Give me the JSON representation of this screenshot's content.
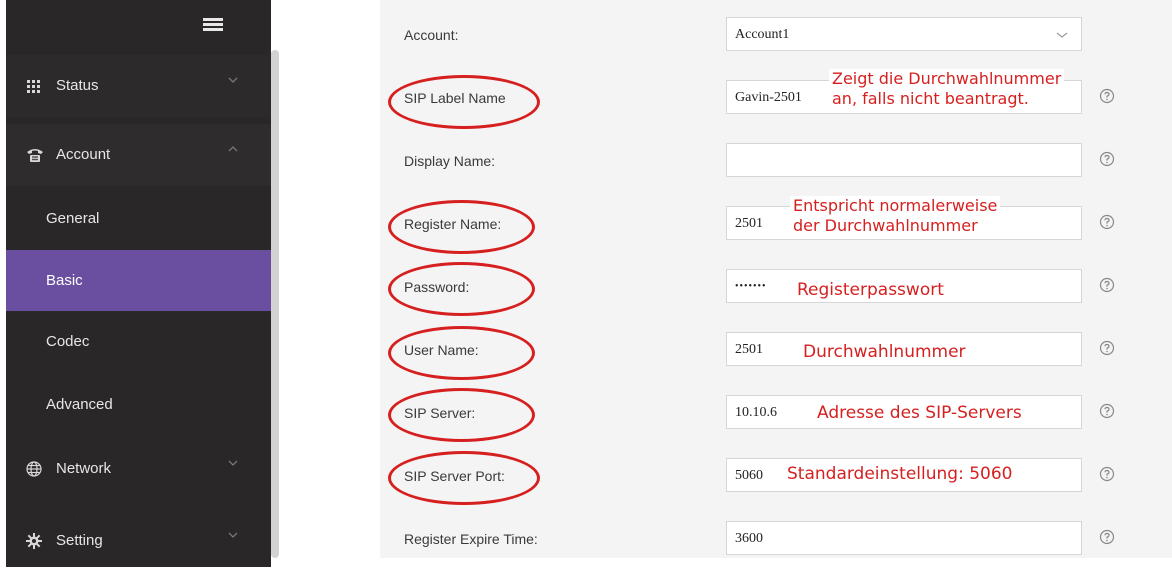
{
  "sidebar": {
    "items": [
      {
        "label": "Status",
        "icon": "grid-icon"
      },
      {
        "label": "Account",
        "icon": "phone-icon"
      },
      {
        "label": "General"
      },
      {
        "label": "Basic"
      },
      {
        "label": "Codec"
      },
      {
        "label": "Advanced"
      },
      {
        "label": "Network",
        "icon": "globe-icon"
      },
      {
        "label": "Setting",
        "icon": "gear-icon"
      }
    ]
  },
  "form": {
    "account": {
      "label": "Account:",
      "value": "Account1"
    },
    "sip_label_name": {
      "label": "SIP Label Name",
      "value": "Gavin-2501"
    },
    "display_name": {
      "label": "Display Name:",
      "value": ""
    },
    "register_name": {
      "label": "Register Name:",
      "value": "2501"
    },
    "password": {
      "label": "Password:",
      "value": "•••••••"
    },
    "user_name": {
      "label": "User Name:",
      "value": "2501"
    },
    "sip_server": {
      "label": "SIP Server:",
      "value": "10.10.6"
    },
    "sip_server_port": {
      "label": "SIP Server Port:",
      "value": "5060"
    },
    "register_expire_time": {
      "label": "Register Expire Time:",
      "value": "3600"
    }
  },
  "annotations": {
    "sip_label_name_line1": "Zeigt die Durchwahlnummer",
    "sip_label_name_line2": "an, falls nicht beantragt.",
    "register_name_line1": "Entspricht normalerweise",
    "register_name_line2": "der Durchwahlnummer",
    "password": "Registerpasswort",
    "user_name": "Durchwahlnummer",
    "sip_server": "Adresse des SIP-Servers",
    "sip_server_port": "Standardeinstellung: 5060"
  },
  "colors": {
    "sidebar_bg": "#2a2729",
    "active_item": "#6a4fa0",
    "annotation_red": "#d62020"
  }
}
